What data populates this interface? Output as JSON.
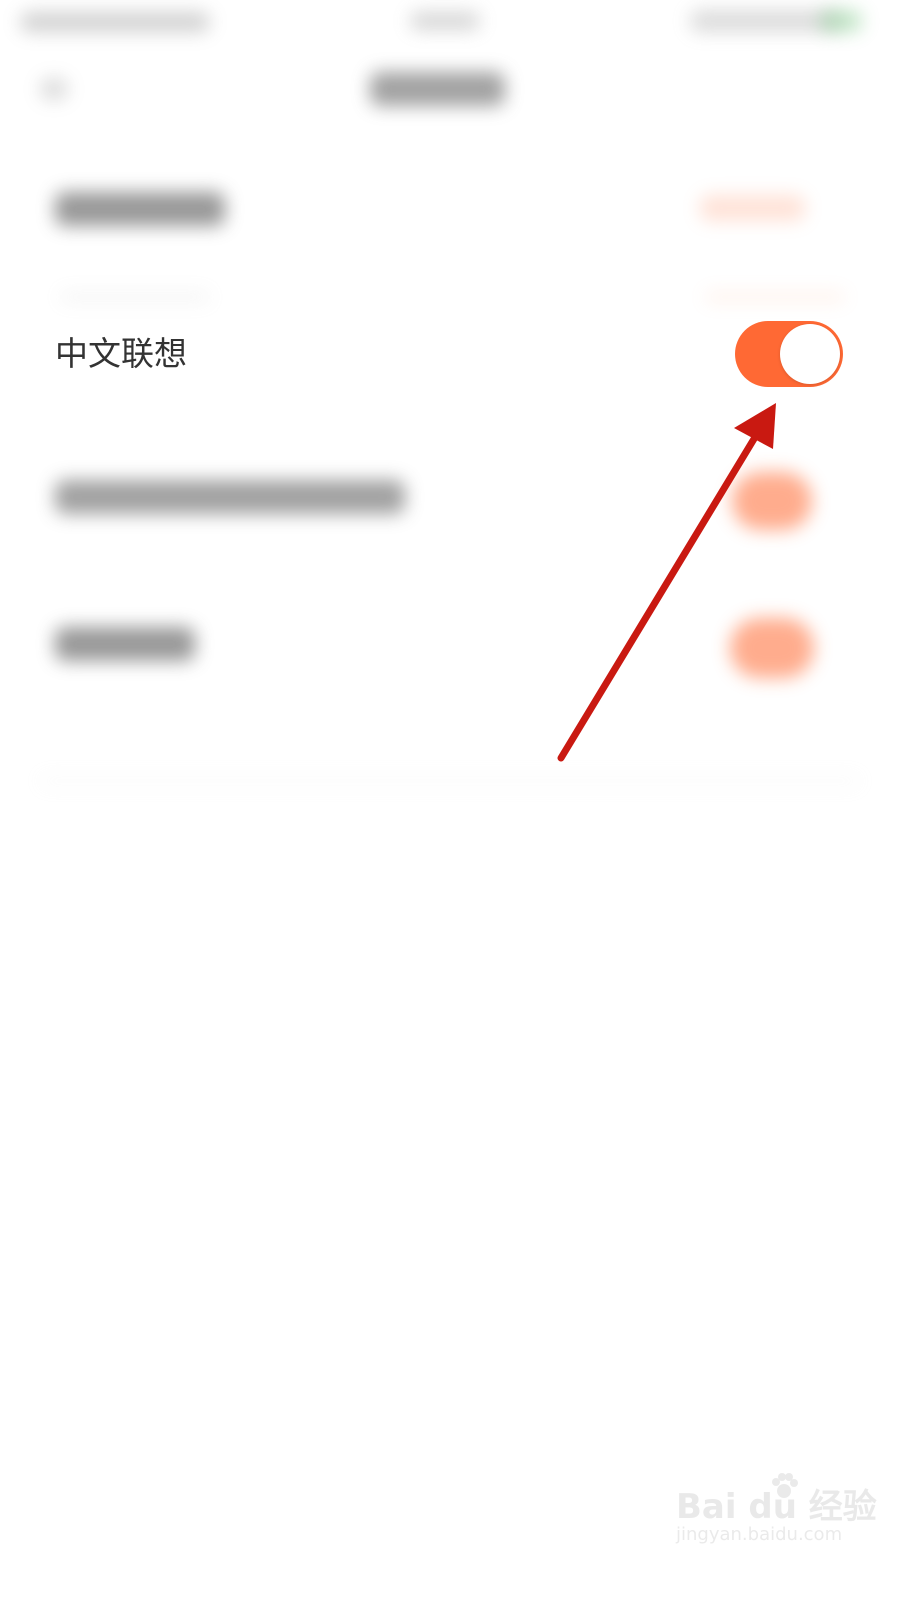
{
  "setting": {
    "label": "中文联想",
    "toggle_on": true
  },
  "watermark": {
    "brand": "Bai du 经验",
    "url": "jingyan.baidu.com"
  },
  "colors": {
    "accent": "#ff6934",
    "annotation_arrow": "#c91911",
    "text": "#333333"
  },
  "icons": {
    "watermark": "baidu-paw-icon",
    "annotation": "arrow-icon"
  }
}
